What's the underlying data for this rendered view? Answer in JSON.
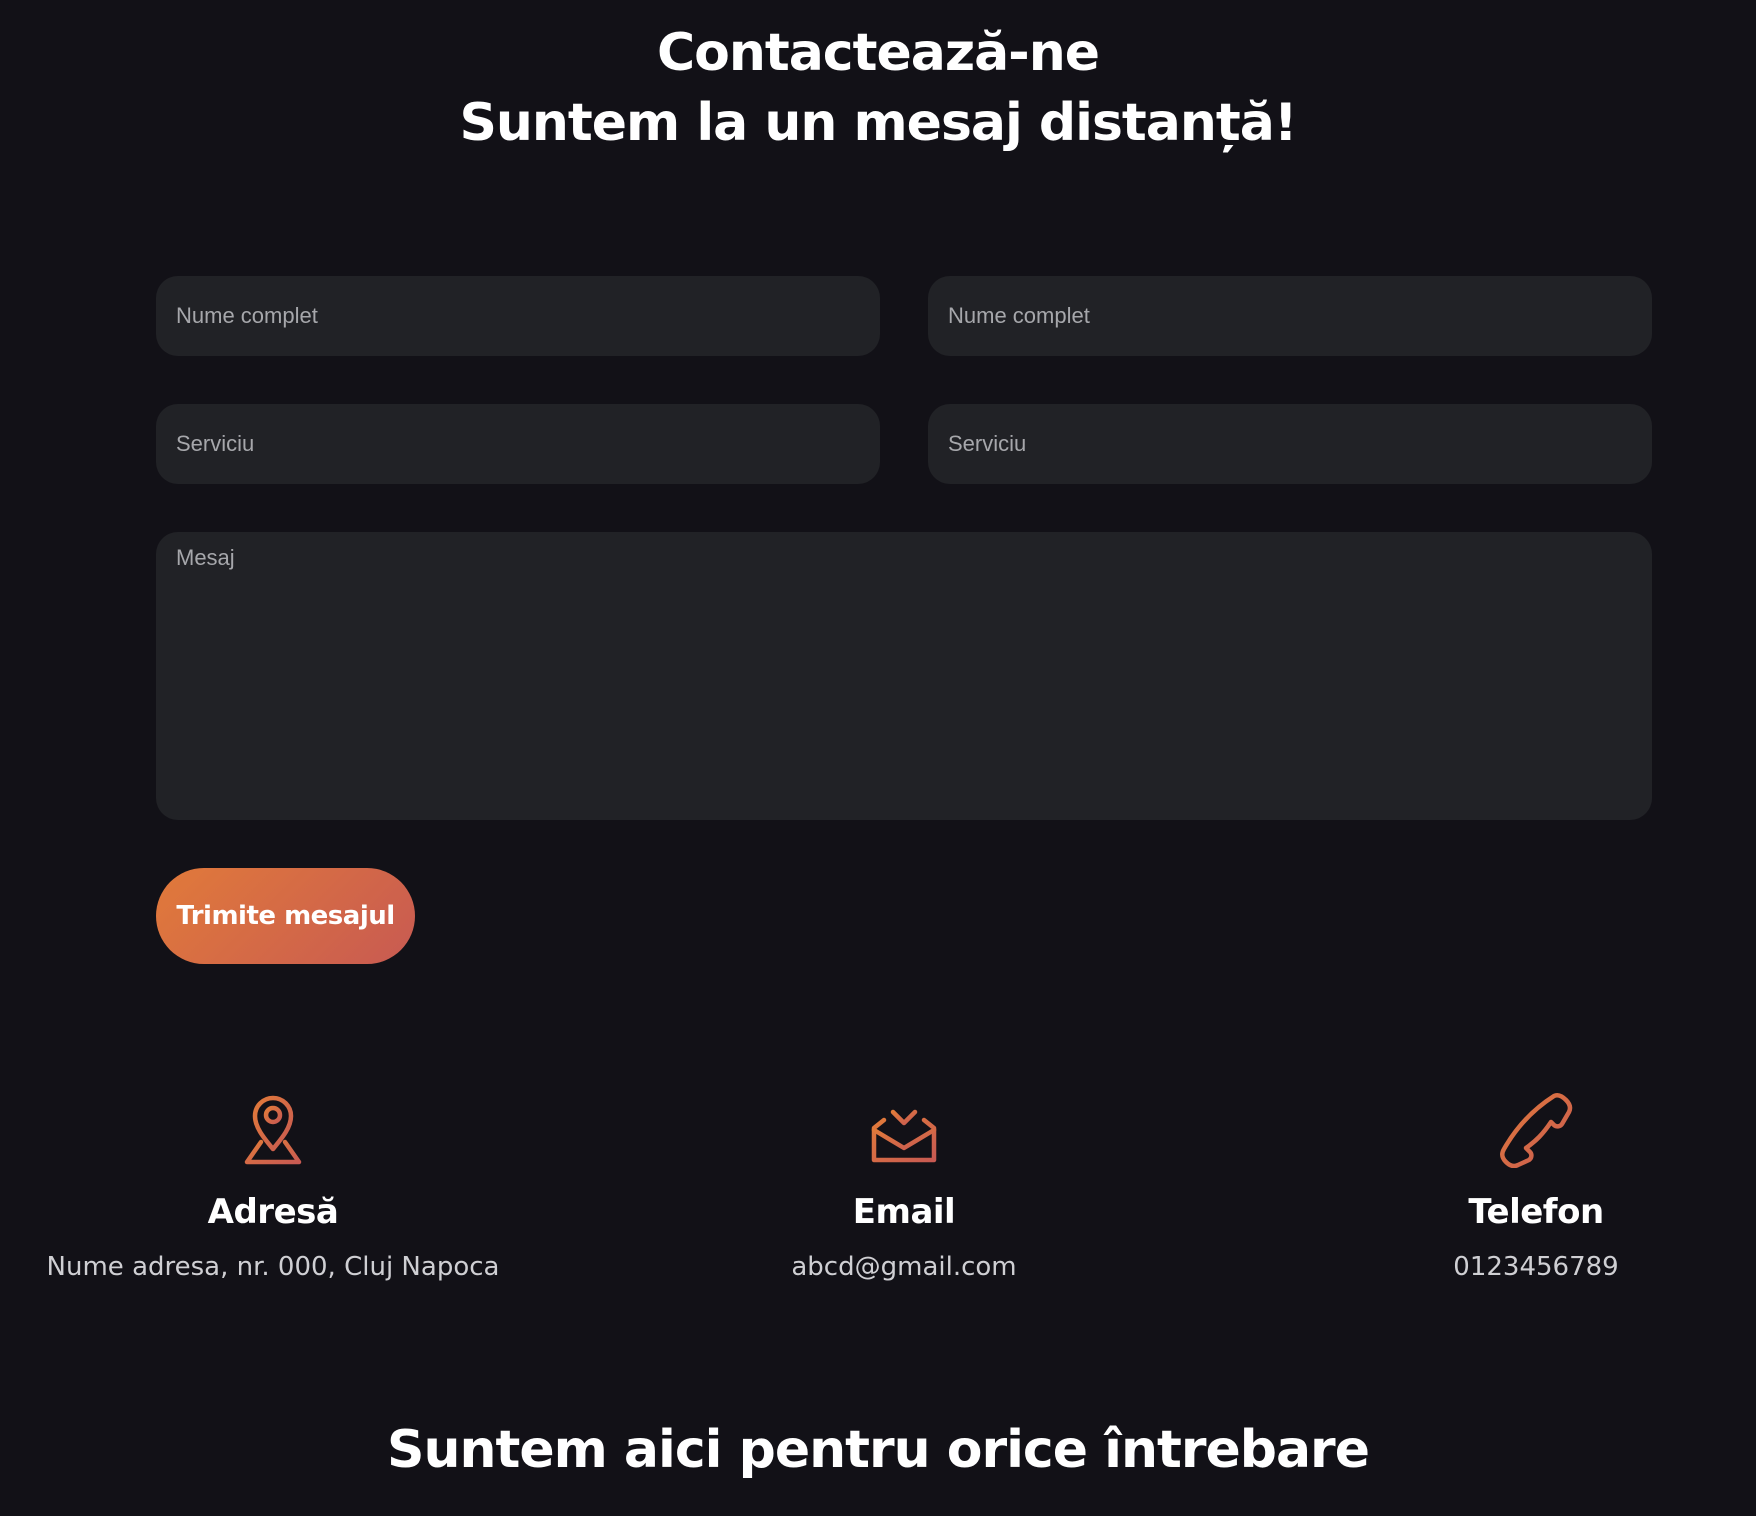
{
  "header": {
    "title_line1": "Contactează-ne",
    "title_line2": "Suntem la un mesaj distanță!"
  },
  "form": {
    "name_left_placeholder": "Nume complet",
    "name_right_placeholder": "Nume complet",
    "service_left_placeholder": "Serviciu",
    "service_right_placeholder": "Serviciu",
    "message_placeholder": "Mesaj",
    "submit_label": "Trimite mesajul"
  },
  "contact": {
    "address": {
      "icon": "map-pin-icon",
      "title": "Adresă",
      "value": "Nume adresa, nr. 000, Cluj Napoca"
    },
    "email": {
      "icon": "inbox-download-icon",
      "title": "Email",
      "value": "abcd@gmail.com"
    },
    "phone": {
      "icon": "phone-icon",
      "title": "Telefon",
      "value": "0123456789"
    }
  },
  "footer": {
    "heading": "Suntem aici pentru orice întrebare"
  },
  "colors": {
    "background": "#121117",
    "field_background": "#212226",
    "accent_start": "#e17a3a",
    "accent_end": "#c85a52"
  }
}
